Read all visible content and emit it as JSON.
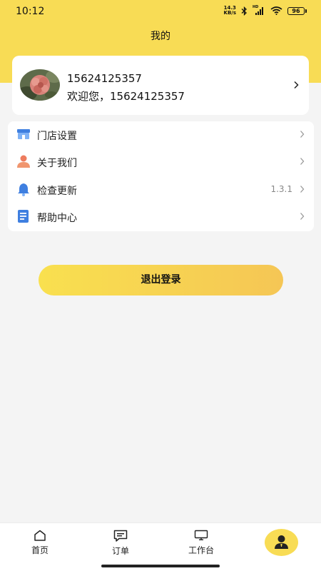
{
  "status_bar": {
    "time": "10:12",
    "net_speed_value": "14.3",
    "net_speed_unit": "KB/s",
    "hd_label": "HD",
    "battery": "96"
  },
  "header": {
    "title": "我的",
    "background_color": "#f8dc55"
  },
  "profile": {
    "phone": "15624125357",
    "welcome": "欢迎您，15624125357"
  },
  "menu": {
    "items": [
      {
        "label": "门店设置",
        "icon": "store-icon"
      },
      {
        "label": "关于我们",
        "icon": "person-icon"
      },
      {
        "label": "检查更新",
        "icon": "bell-icon",
        "value": "1.3.1"
      },
      {
        "label": "帮助中心",
        "icon": "document-icon"
      }
    ]
  },
  "logout": {
    "label": "退出登录"
  },
  "tab_bar": {
    "tabs": [
      {
        "label": "首页",
        "icon": "home-icon"
      },
      {
        "label": "订单",
        "icon": "order-icon"
      },
      {
        "label": "工作台",
        "icon": "workbench-icon"
      },
      {
        "label": "",
        "icon": "user-icon",
        "active": true
      }
    ]
  },
  "colors": {
    "accent": "#f8dc55",
    "button_gradient_start": "#f9e04f",
    "button_gradient_end": "#f5c655"
  }
}
